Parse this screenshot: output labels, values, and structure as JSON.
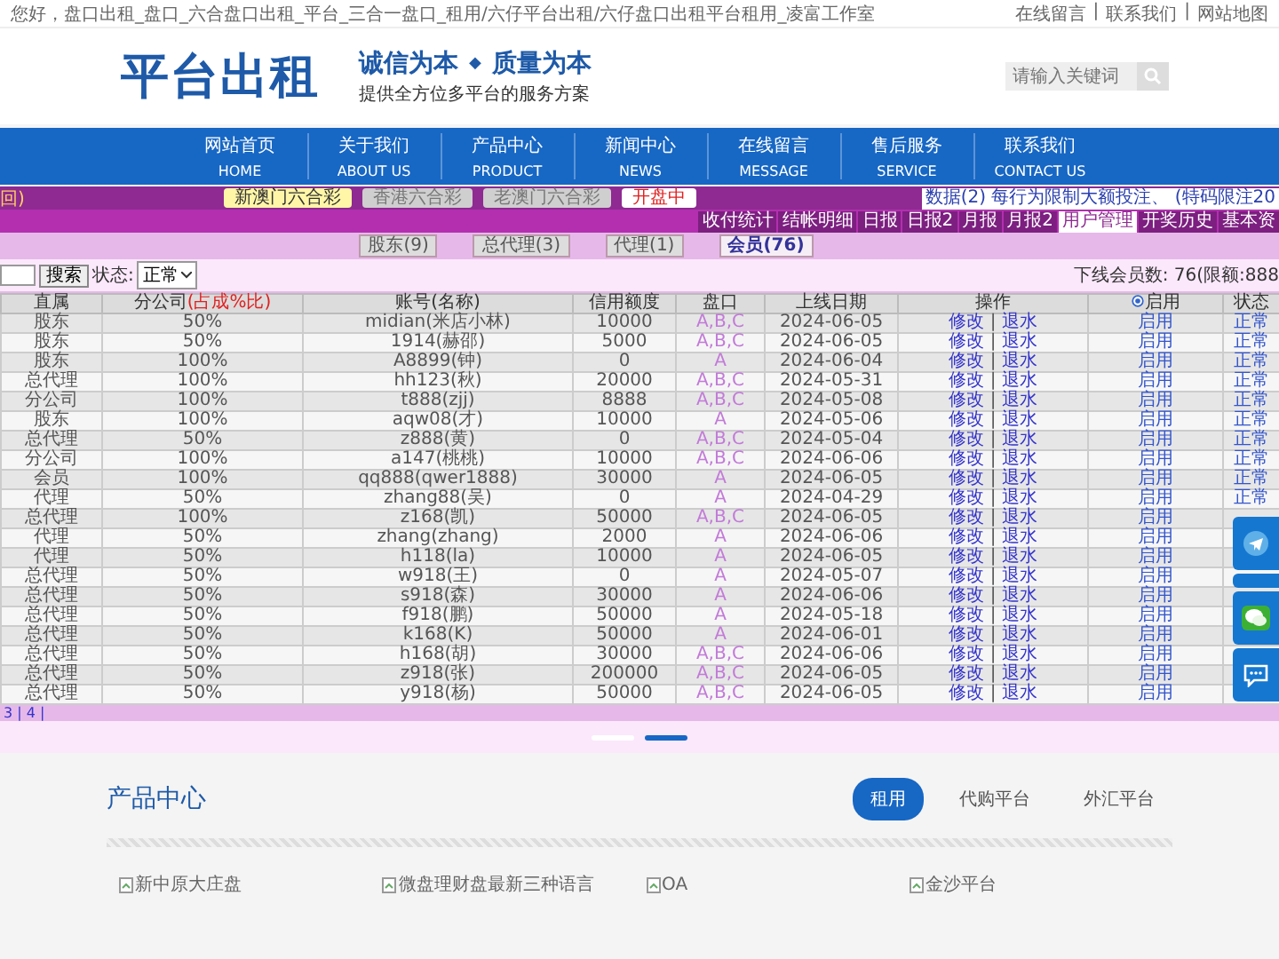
{
  "top_bar": {
    "greeting": "您好，盘口出租_盘口_六合盘口出租_平台_三合一盘口_租用/六仔平台出租/六仔盘口出租平台租用_凌富工作室",
    "links": [
      "在线留言",
      "联系我们",
      "网站地图"
    ],
    "link_sep": "|"
  },
  "header": {
    "logo": "平台出租",
    "slogan_first": "诚信为本",
    "slogan_mark": "◆",
    "slogan_second": "质量为本",
    "subtitle": "提供全方位多平台的服务方案",
    "search": {
      "placeholder": "请输入关键词"
    }
  },
  "nav": [
    {
      "label": "网站首页",
      "sub": "HOME"
    },
    {
      "label": "关于我们",
      "sub": "ABOUT US"
    },
    {
      "label": "产品中心",
      "sub": "PRODUCT"
    },
    {
      "label": "新闻中心",
      "sub": "NEWS"
    },
    {
      "label": "在线留言",
      "sub": "MESSAGE"
    },
    {
      "label": "售后服务",
      "sub": "SERVICE"
    },
    {
      "label": "联系我们",
      "sub": "CONTACT US"
    }
  ],
  "admin": {
    "back_label": "回)",
    "lottery_tabs": [
      {
        "label": "新澳门六合彩",
        "selected": true
      },
      {
        "label": "香港六合彩",
        "selected": false
      },
      {
        "label": "老澳门六合彩",
        "selected": false
      }
    ],
    "status_tag": "开盘中",
    "notice": "数据(2) 每行为限制大额投注、 (特码限注20",
    "menu_tabs": [
      {
        "label": "收付统计",
        "selected": false
      },
      {
        "label": "结帐明细",
        "selected": false
      },
      {
        "label": "日报",
        "selected": false
      },
      {
        "label": "日报2",
        "selected": false
      },
      {
        "label": "月报",
        "selected": false
      },
      {
        "label": "月报2",
        "selected": false
      },
      {
        "label": "用户管理",
        "selected": true
      },
      {
        "label": "开奖历史",
        "selected": false
      },
      {
        "label": "基本资",
        "selected": false
      }
    ],
    "level_buttons": [
      {
        "label": "股东(9)",
        "selected": false
      },
      {
        "label": "总代理(3)",
        "selected": false
      },
      {
        "label": "代理(1)",
        "selected": false
      },
      {
        "label": "会员(76)",
        "selected": true
      }
    ],
    "search_button": "搜索",
    "status_label": "状态:",
    "status_select": "正常",
    "summary": "下线会员数: 76(限额:888",
    "table": {
      "columns": [
        {
          "label": "直属"
        },
        {
          "label": "分公司",
          "note": "(占成%比)"
        },
        {
          "label": "账号(名称)"
        },
        {
          "label": "信用额度"
        },
        {
          "label": "盘口"
        },
        {
          "label": "上线日期"
        },
        {
          "label": "操作"
        },
        {
          "label": "启用",
          "radio": true
        },
        {
          "label": "状态"
        }
      ],
      "op_sep": "|",
      "rows": [
        {
          "role": "股东",
          "share": "50%",
          "account": "midian(米店小林)",
          "credit": "10000",
          "market": "A,B,C",
          "date": "2024-06-05",
          "edit": "修改",
          "rebate": "退水",
          "enable": "启用",
          "status": "正常"
        },
        {
          "role": "股东",
          "share": "50%",
          "account": "1914(赫邵)",
          "credit": "5000",
          "market": "A,B,C",
          "date": "2024-06-05",
          "edit": "修改",
          "rebate": "退水",
          "enable": "启用",
          "status": "正常"
        },
        {
          "role": "股东",
          "share": "100%",
          "account": "A8899(钟)",
          "credit": "0",
          "market": "A",
          "date": "2024-06-04",
          "edit": "修改",
          "rebate": "退水",
          "enable": "启用",
          "status": "正常"
        },
        {
          "role": "总代理",
          "share": "100%",
          "account": "hh123(秋)",
          "credit": "20000",
          "market": "A,B,C",
          "date": "2024-05-31",
          "edit": "修改",
          "rebate": "退水",
          "enable": "启用",
          "status": "正常"
        },
        {
          "role": "分公司",
          "share": "100%",
          "account": "t888(zjj)",
          "credit": "8888",
          "market": "A,B,C",
          "date": "2024-05-08",
          "edit": "修改",
          "rebate": "退水",
          "enable": "启用",
          "status": "正常"
        },
        {
          "role": "股东",
          "share": "100%",
          "account": "aqw08(才)",
          "credit": "10000",
          "market": "A",
          "date": "2024-05-06",
          "edit": "修改",
          "rebate": "退水",
          "enable": "启用",
          "status": "正常"
        },
        {
          "role": "总代理",
          "share": "50%",
          "account": "z888(黄)",
          "credit": "0",
          "market": "A,B,C",
          "date": "2024-05-04",
          "edit": "修改",
          "rebate": "退水",
          "enable": "启用",
          "status": "正常"
        },
        {
          "role": "分公司",
          "share": "100%",
          "account": "a147(桃桃)",
          "credit": "10000",
          "market": "A,B,C",
          "date": "2024-06-06",
          "edit": "修改",
          "rebate": "退水",
          "enable": "启用",
          "status": "正常"
        },
        {
          "role": "会员",
          "share": "100%",
          "account": "qq888(qwer1888)",
          "credit": "30000",
          "market": "A",
          "date": "2024-06-05",
          "edit": "修改",
          "rebate": "退水",
          "enable": "启用",
          "status": "正常"
        },
        {
          "role": "代理",
          "share": "50%",
          "account": "zhang88(吴)",
          "credit": "0",
          "market": "A",
          "date": "2024-04-29",
          "edit": "修改",
          "rebate": "退水",
          "enable": "启用",
          "status": "正常"
        },
        {
          "role": "总代理",
          "share": "100%",
          "account": "z168(凯)",
          "credit": "50000",
          "market": "A,B,C",
          "date": "2024-06-05",
          "edit": "修改",
          "rebate": "退水",
          "enable": "启用"
        },
        {
          "role": "代理",
          "share": "50%",
          "account": "zhang(zhang)",
          "credit": "2000",
          "market": "A",
          "date": "2024-06-06",
          "edit": "修改",
          "rebate": "退水",
          "enable": "启用"
        },
        {
          "role": "代理",
          "share": "50%",
          "account": "h118(la)",
          "credit": "10000",
          "market": "A",
          "date": "2024-06-05",
          "edit": "修改",
          "rebate": "退水",
          "enable": "启用"
        },
        {
          "role": "总代理",
          "share": "50%",
          "account": "w918(王)",
          "credit": "0",
          "market": "A",
          "date": "2024-05-07",
          "edit": "修改",
          "rebate": "退水",
          "enable": "启用"
        },
        {
          "role": "总代理",
          "share": "50%",
          "account": "s918(森)",
          "credit": "30000",
          "market": "A",
          "date": "2024-06-06",
          "edit": "修改",
          "rebate": "退水",
          "enable": "启用"
        },
        {
          "role": "总代理",
          "share": "50%",
          "account": "f918(鹏)",
          "credit": "50000",
          "market": "A",
          "date": "2024-05-18",
          "edit": "修改",
          "rebate": "退水",
          "enable": "启用"
        },
        {
          "role": "总代理",
          "share": "50%",
          "account": "k168(K)",
          "credit": "50000",
          "market": "A",
          "date": "2024-06-01",
          "edit": "修改",
          "rebate": "退水",
          "enable": "启用"
        },
        {
          "role": "总代理",
          "share": "50%",
          "account": "h168(胡)",
          "credit": "30000",
          "market": "A,B,C",
          "date": "2024-06-06",
          "edit": "修改",
          "rebate": "退水",
          "enable": "启用"
        },
        {
          "role": "总代理",
          "share": "50%",
          "account": "z918(张)",
          "credit": "200000",
          "market": "A,B,C",
          "date": "2024-06-05",
          "edit": "修改",
          "rebate": "退水",
          "enable": "启用"
        },
        {
          "role": "总代理",
          "share": "50%",
          "account": "y918(杨)",
          "credit": "50000",
          "market": "A,B,C",
          "date": "2024-06-05",
          "edit": "修改",
          "rebate": "退水",
          "enable": "启用"
        }
      ]
    },
    "pagination": "3 | 4 |"
  },
  "slider_dots": [
    {
      "selected": false
    },
    {
      "selected": true
    }
  ],
  "products": {
    "title": "产品中心",
    "tabs": [
      {
        "label": "租用",
        "selected": true
      },
      {
        "label": "代购平台",
        "selected": false
      },
      {
        "label": "外汇平台",
        "selected": false
      }
    ],
    "items": [
      "新中原大庄盘",
      "微盘理财盘最新三种语言",
      "OA",
      "金沙平台"
    ]
  },
  "float_buttons": [
    {
      "kind": "telegram"
    },
    {
      "kind": "blank"
    },
    {
      "kind": "wechat"
    },
    {
      "kind": "chat"
    }
  ]
}
